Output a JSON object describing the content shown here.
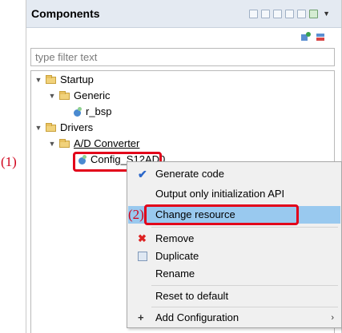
{
  "panel": {
    "title": "Components",
    "filter_placeholder": "type filter text"
  },
  "tree": {
    "startup": "Startup",
    "generic": "Generic",
    "r_bsp": "r_bsp",
    "drivers": "Drivers",
    "ad_converter": "A/D Converter",
    "config": "Config_S12AD0"
  },
  "annotations": {
    "step1": "(1)",
    "step2": "(2)"
  },
  "context_menu": {
    "generate_code": "Generate code",
    "output_init_api": "Output only initialization API",
    "change_resource": "Change resource",
    "remove": "Remove",
    "duplicate": "Duplicate",
    "rename": "Rename",
    "reset_default": "Reset to default",
    "add_configuration": "Add Configuration"
  },
  "colors": {
    "annotation_red": "#e2001a",
    "selection_blue": "#99c9ef"
  }
}
